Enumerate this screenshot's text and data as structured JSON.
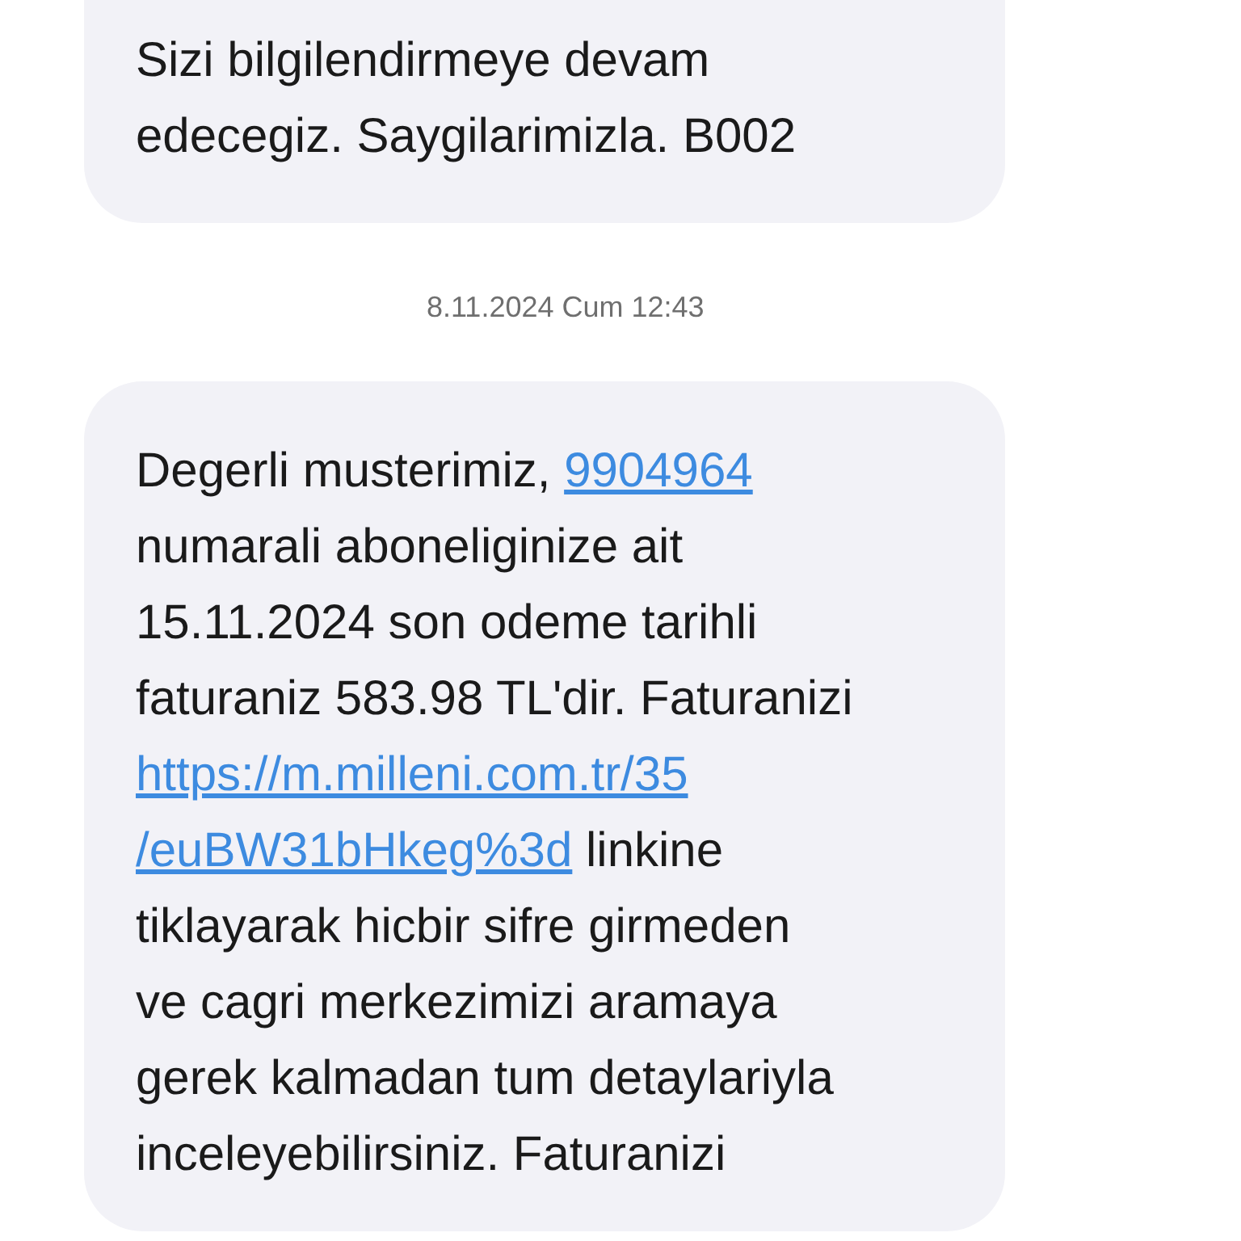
{
  "messages": [
    {
      "parts": [
        {
          "kind": "text",
          "text": "Sizi bilgilendirmeye devam\nedecegiz. Saygilarimizla. B002"
        }
      ]
    },
    {
      "kind": "timestamp",
      "text": "8.11.2024 Cum 12:43"
    },
    {
      "parts": [
        {
          "kind": "text",
          "text": "Degerli musterimiz, "
        },
        {
          "kind": "link",
          "text": "9904964"
        },
        {
          "kind": "text",
          "text": "\nnumarali aboneliginize ait\n15.11.2024 son odeme tarihli\nfaturaniz 583.98 TL'dir. Faturanizi\n"
        },
        {
          "kind": "link",
          "text": "https://m.milleni.com.tr/35"
        },
        {
          "kind": "break"
        },
        {
          "kind": "link",
          "text": "/euBW31bHkeg%3d"
        },
        {
          "kind": "text",
          "text": " linkine\ntiklayarak hicbir sifre girmeden\nve cagri merkezimizi aramaya\ngerek kalmadan tum detaylariyla\ninceleyebilirsiniz. Faturanizi"
        }
      ]
    }
  ]
}
